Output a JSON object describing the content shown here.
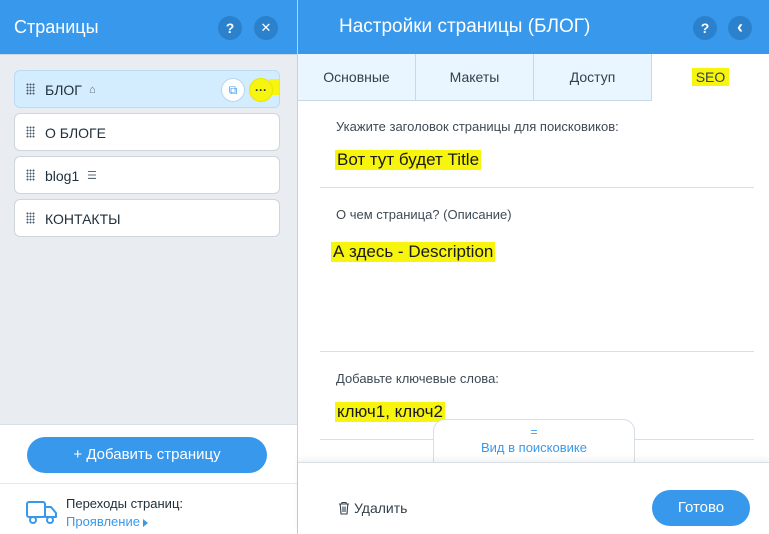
{
  "left_panel": {
    "title": "Страницы",
    "help_label": "?",
    "close_label": "✕",
    "pages": [
      {
        "label": "БЛОГ",
        "mark": "⌂"
      },
      {
        "label": "О БЛОГЕ",
        "mark": ""
      },
      {
        "label": "blog1",
        "mark": "☰"
      },
      {
        "label": "КОНТАКТЫ",
        "mark": ""
      }
    ],
    "item_actions": {
      "duplicate_label": "⧉",
      "more_label": "···"
    },
    "add_page_label": "+ Добавить страницу",
    "transitions": {
      "title": "Переходы страниц:",
      "value": "Проявление"
    }
  },
  "right_panel": {
    "title": "Настройки страницы (БЛОГ)",
    "help_label": "?",
    "back_label": "‹",
    "tabs": [
      "Основные",
      "Макеты",
      "Доступ",
      "SEO"
    ],
    "active_tab": "SEO",
    "seo": {
      "title_label": "Укажите заголовок страницы для поисковиков:",
      "title_value": "Вот тут будет Title",
      "description_label": "О чем страница? (Описание)",
      "description_value": "А здесь - Description",
      "keywords_label": "Добавьте ключевые слова:",
      "keywords_value": "ключ1, ключ2"
    },
    "preview": {
      "handle": "=",
      "label": "Вид в поисковике"
    },
    "footer": {
      "delete_label": "Удалить",
      "done_label": "Готово"
    }
  },
  "colors": {
    "accent": "#3899ec",
    "highlight": "#f7f40e",
    "left_bg": "#e9edf1",
    "selected_item": "#d3edff"
  }
}
